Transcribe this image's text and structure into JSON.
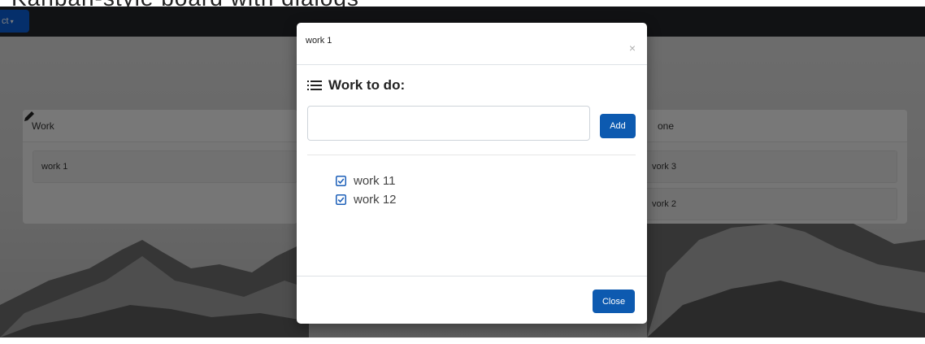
{
  "page": {
    "heading": "Kanban-style board with dialogs"
  },
  "navbar": {
    "project_label": "ct",
    "caret": "▾"
  },
  "columns": [
    {
      "title": "Work",
      "cards": [
        "work 1"
      ]
    },
    {
      "title": "one",
      "cards": [
        "vork 3",
        "vork 2"
      ]
    }
  ],
  "modal": {
    "title": "work 1",
    "close_glyph": "×",
    "section_heading": "Work to do:",
    "input_value": "",
    "input_placeholder": "",
    "add_label": "Add",
    "tasks": [
      {
        "label": "work 11",
        "checked": true
      },
      {
        "label": "work 12",
        "checked": true
      }
    ],
    "close_label": "Close"
  },
  "icons": {
    "edit": "pencil-icon",
    "list": "list-icon",
    "checkbox": "checkbox-checked-icon"
  },
  "colors": {
    "navbar": "#222529",
    "primary": "#0d5ab0",
    "backdrop": "rgba(0,0,0,0.5)",
    "check": "#1c5fb8"
  }
}
